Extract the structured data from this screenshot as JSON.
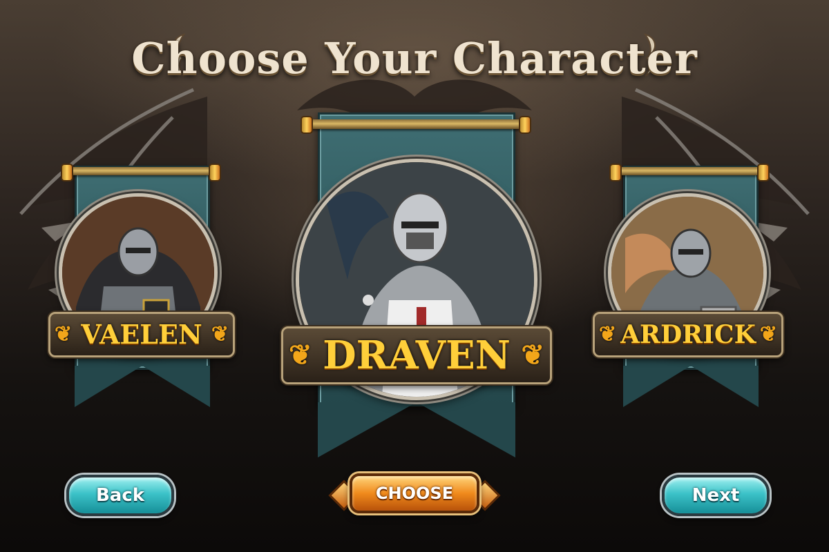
{
  "screen": {
    "title": "Choose Your Character"
  },
  "characters": [
    {
      "name": "VAELEN",
      "selected": false
    },
    {
      "name": "DRAVEN",
      "selected": true
    },
    {
      "name": "ARDRICK",
      "selected": false
    }
  ],
  "buttons": {
    "back_label": "Back",
    "choose_label": "CHOOSE",
    "next_label": "Next"
  },
  "colors": {
    "banner_teal": "#2d5559",
    "nameplate_gold": "#ffcf3a",
    "button_teal": "#3cc2c8",
    "button_orange": "#f08a1c"
  },
  "icons": [
    "dragon-wing-icon",
    "knight-portrait",
    "dragon-ornament-icon"
  ]
}
